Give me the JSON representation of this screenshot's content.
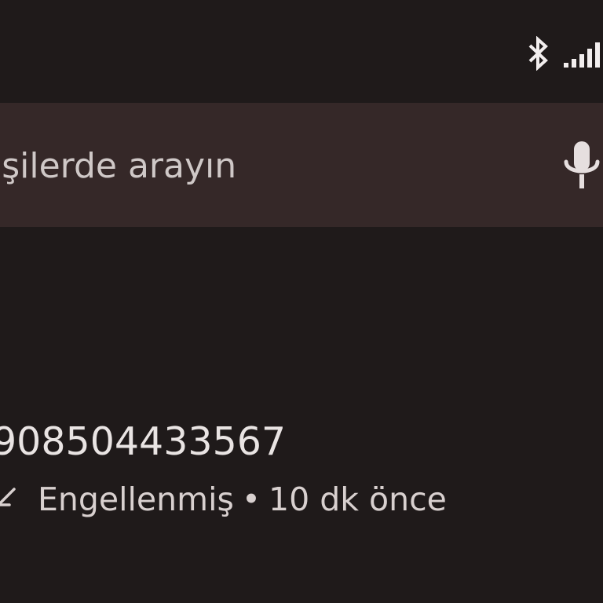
{
  "status_bar": {
    "icons": [
      "bluetooth-icon",
      "signal-strength-icon"
    ]
  },
  "search": {
    "placeholder": "işilerde arayın",
    "mic_icon": "microphone-icon"
  },
  "call_log": {
    "entries": [
      {
        "number": "908504433567",
        "status": "Engellenmiş",
        "separator": "•",
        "time": "10 dk önce",
        "icon": "blocked-call-icon"
      }
    ]
  },
  "colors": {
    "background": "#1f1a1a",
    "search_bar": "#352828",
    "text_primary": "#e9e4e3",
    "text_secondary": "#d8d0cf"
  }
}
